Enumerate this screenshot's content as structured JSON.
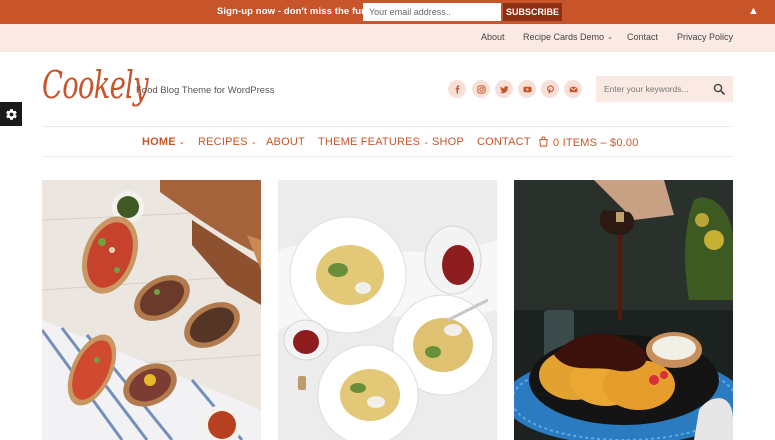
{
  "signup": {
    "text": "Sign-up now - don't miss the fun!",
    "email_placeholder": "Your email address..",
    "button_label": "SUBSCRIBE",
    "close_glyph": "▲"
  },
  "top_nav": {
    "items": [
      "About",
      "Recipe Cards Demo",
      "Contact",
      "Privacy Policy"
    ]
  },
  "site": {
    "logo": "Cookely",
    "tagline": "Food Blog Theme for WordPress"
  },
  "social_icons": [
    "facebook-icon",
    "instagram-icon",
    "twitter-icon",
    "youtube-icon",
    "pinterest-icon",
    "email-icon"
  ],
  "search": {
    "placeholder": "Enter your keywords..."
  },
  "main_nav": {
    "home": "HOME",
    "recipes": "RECIPES",
    "about": "ABOUT",
    "theme_features": "THEME FEATURES",
    "shop": "SHOP",
    "contact": "CONTACT",
    "cart": "0 ITEMS – $0.00"
  },
  "colors": {
    "accent": "#c8552a",
    "accent_dark": "#8c2f12",
    "top_bar_bg": "#fbe9e3"
  },
  "cards": [
    {
      "image": "bruschetta-platter"
    },
    {
      "image": "spaghetti-plates"
    },
    {
      "image": "pancakes-chocolate"
    }
  ]
}
